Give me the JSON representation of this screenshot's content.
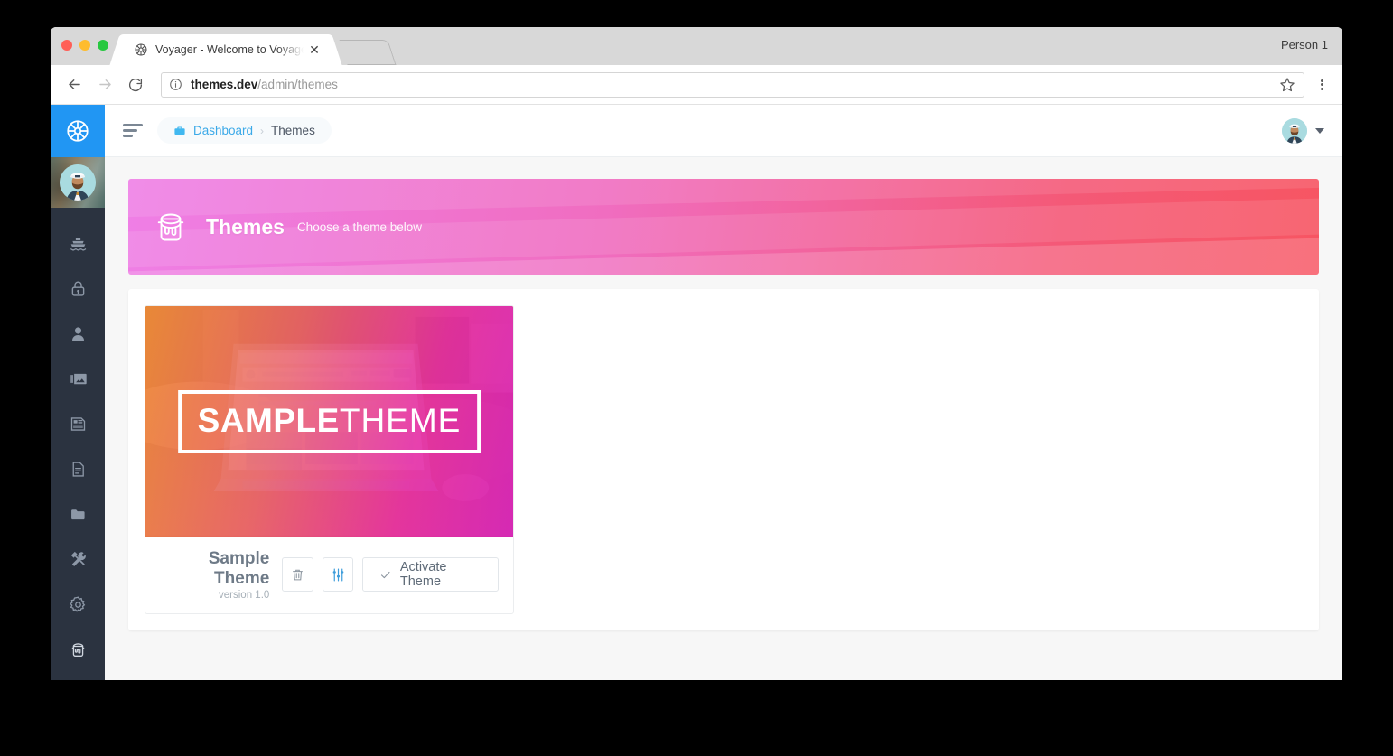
{
  "browser": {
    "tab": {
      "title": "Voyager - Welcome to Voyager",
      "favicon_icon": "ship-wheel-icon",
      "close_icon": "close-icon"
    },
    "new_tab_label": "",
    "profile_label": "Person 1",
    "toolbar": {
      "back_icon": "arrow-left-icon",
      "forward_icon": "arrow-right-icon",
      "reload_icon": "reload-icon",
      "site_info_icon": "info-circle-icon",
      "url_host": "themes.dev",
      "url_path": "/admin/themes",
      "bookmark_icon": "star-icon",
      "menu_icon": "more-vertical-icon"
    }
  },
  "sidebar": {
    "brand_icon": "ship-wheel-icon",
    "avatar_icon": "captain-avatar",
    "items": [
      {
        "name": "sidebar-item-dashboard",
        "icon": "ship-icon"
      },
      {
        "name": "sidebar-item-roles",
        "icon": "lock-icon"
      },
      {
        "name": "sidebar-item-users",
        "icon": "user-icon"
      },
      {
        "name": "sidebar-item-media",
        "icon": "image-icon"
      },
      {
        "name": "sidebar-item-posts",
        "icon": "news-icon"
      },
      {
        "name": "sidebar-item-pages",
        "icon": "file-icon"
      },
      {
        "name": "sidebar-item-categories",
        "icon": "folder-icon"
      },
      {
        "name": "sidebar-item-tools",
        "icon": "tools-icon"
      },
      {
        "name": "sidebar-item-settings",
        "icon": "gear-icon"
      },
      {
        "name": "sidebar-item-themes",
        "icon": "paint-bucket-icon",
        "active": true
      }
    ]
  },
  "topbar": {
    "menu_toggle_icon": "hamburger-icon",
    "breadcrumb": {
      "home_icon": "briefcase-icon",
      "home_label": "Dashboard",
      "separator": "›",
      "current_label": "Themes"
    },
    "avatar_icon": "captain-avatar",
    "dropdown_icon": "caret-down-icon"
  },
  "banner": {
    "icon": "paint-bucket-icon",
    "title": "Themes",
    "subtitle": "Choose a theme below",
    "gradient_start": "#ef7fe6",
    "gradient_end": "#f75562"
  },
  "themes": [
    {
      "preview_label_bold": "SAMPLE",
      "preview_label_light": "THEME",
      "name": "Sample Theme",
      "version": "version 1.0",
      "delete_icon": "trash-icon",
      "settings_icon": "sliders-icon",
      "activate_icon": "check-icon",
      "activate_label": "Activate Theme"
    }
  ]
}
